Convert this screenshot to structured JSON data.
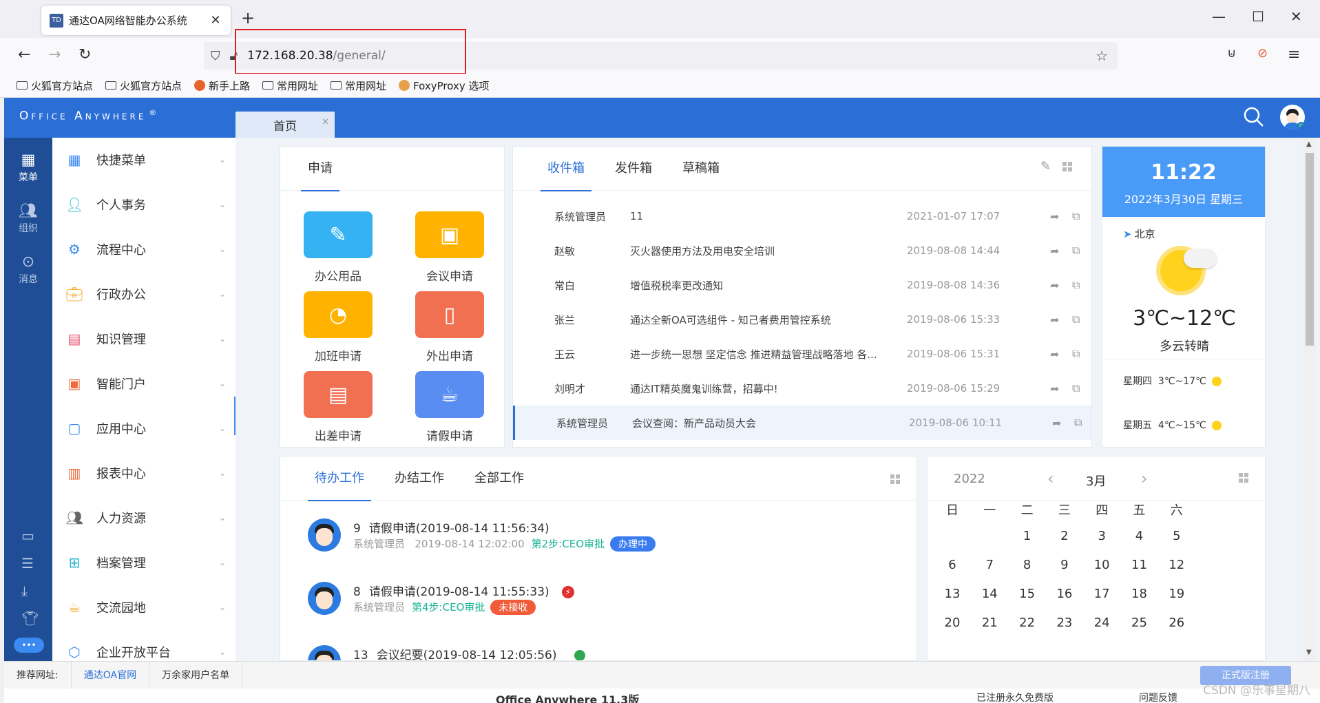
{
  "browser": {
    "tab_title": "通达OA网络智能办公系统",
    "tab_favicon": "TD",
    "url_host": "172.168.20.38",
    "url_path": "/general/",
    "bookmarks": [
      "火狐官方站点",
      "火狐官方站点",
      "新手上路",
      "常用网址",
      "常用网址",
      "FoxyProxy 选项"
    ]
  },
  "app": {
    "logo": "Office Anywhere",
    "logo_mark": "®",
    "home_tab": "首页",
    "accent": "#2b6fd6"
  },
  "rail": {
    "items": [
      {
        "label": "菜单",
        "icon": "grid-icon"
      },
      {
        "label": "组织",
        "icon": "people-icon"
      },
      {
        "label": "消息",
        "icon": "chat-icon"
      }
    ]
  },
  "menu": {
    "items": [
      {
        "label": "快捷菜单",
        "icon": "quick-menu-icon"
      },
      {
        "label": "个人事务",
        "icon": "person-icon"
      },
      {
        "label": "流程中心",
        "icon": "flow-icon"
      },
      {
        "label": "行政办公",
        "icon": "briefcase-icon"
      },
      {
        "label": "知识管理",
        "icon": "book-icon"
      },
      {
        "label": "智能门户",
        "icon": "portal-icon"
      },
      {
        "label": "应用中心",
        "icon": "app-center-icon"
      },
      {
        "label": "报表中心",
        "icon": "bar-chart-icon"
      },
      {
        "label": "人力资源",
        "icon": "hr-icon"
      },
      {
        "label": "档案管理",
        "icon": "archive-icon"
      },
      {
        "label": "交流园地",
        "icon": "cup-icon"
      },
      {
        "label": "企业开放平台",
        "icon": "cube-icon"
      }
    ]
  },
  "apply": {
    "tab": "申请",
    "apps": [
      {
        "label": "办公用品",
        "color": "#35b2f2"
      },
      {
        "label": "会议申请",
        "color": "#ffb300"
      },
      {
        "label": "加班申请",
        "color": "#ffb300"
      },
      {
        "label": "外出申请",
        "color": "#f27052"
      },
      {
        "label": "出差申请",
        "color": "#f27052"
      },
      {
        "label": "请假申请",
        "color": "#5a8df2"
      }
    ]
  },
  "mail": {
    "tabs": [
      "收件箱",
      "发件箱",
      "草稿箱"
    ],
    "rows": [
      {
        "from": "系统管理员",
        "subject": "11",
        "time": "2021-01-07 17:07"
      },
      {
        "from": "赵敏",
        "subject": "灭火器使用方法及用电安全培训",
        "time": "2019-08-08 14:44"
      },
      {
        "from": "常白",
        "subject": "增值税税率更改通知",
        "time": "2019-08-08 14:36"
      },
      {
        "from": "张兰",
        "subject": "通达全新OA可选组件 - 知己者费用管控系统",
        "time": "2019-08-06 15:33"
      },
      {
        "from": "王云",
        "subject": "进一步统一思想 坚定信念 推进精益管理战略落地 各...",
        "time": "2019-08-06 15:31"
      },
      {
        "from": "刘明才",
        "subject": "通达IT精英魔鬼训练营，招募中!",
        "time": "2019-08-06 15:29"
      },
      {
        "from": "系统管理员",
        "subject": "会议查阅：新产品动员大会",
        "time": "2019-08-06 10:11"
      }
    ]
  },
  "weather": {
    "time": "11:22",
    "date": "2022年3月30日 星期三",
    "city": "北京",
    "temp": "3℃~12℃",
    "desc": "多云转晴",
    "forecast": [
      {
        "day": "星期四",
        "temp": "3℃~17℃"
      },
      {
        "day": "星期五",
        "temp": "4℃~15℃"
      }
    ]
  },
  "work": {
    "tabs": [
      "待办工作",
      "办结工作",
      "全部工作"
    ],
    "tasks": [
      {
        "num": "9",
        "title": "请假申请(2019-08-14 11:56:34)",
        "user": "系统管理员",
        "time": "2019-08-14 12:02:00",
        "step": "第2步:CEO审批",
        "badge": "办理中",
        "badge_color": "#3a7bf0"
      },
      {
        "num": "8",
        "title": "请假申请(2019-08-14 11:55:33)",
        "user": "系统管理员",
        "time": "",
        "step": "第4步:CEO审批",
        "badge": "未接收",
        "badge_color": "#f25b3a"
      },
      {
        "num": "13",
        "title": "会议纪要(2019-08-14 12:05:56)",
        "user": "",
        "time": "",
        "step": "",
        "badge": "",
        "badge_color": ""
      }
    ]
  },
  "calendar": {
    "year": "2022",
    "month": "3月",
    "weekdays": [
      "日",
      "一",
      "二",
      "三",
      "四",
      "五",
      "六"
    ],
    "rows": [
      [
        "",
        "",
        "1",
        "2",
        "3",
        "4",
        "5"
      ],
      [
        "6",
        "7",
        "8",
        "9",
        "10",
        "11",
        "12"
      ],
      [
        "13",
        "14",
        "15",
        "16",
        "17",
        "18",
        "19"
      ],
      [
        "20",
        "21",
        "22",
        "23",
        "24",
        "25",
        "26"
      ]
    ]
  },
  "footer": {
    "label": "推荐网址:",
    "links": [
      "通达OA官网",
      "万余家用户名单"
    ],
    "register": "正式版注册",
    "version": "Office Anywhere 11.3版",
    "free": "已注册永久免费版",
    "feedback": "问题反馈",
    "watermark": "CSDN @乐事星期八"
  }
}
